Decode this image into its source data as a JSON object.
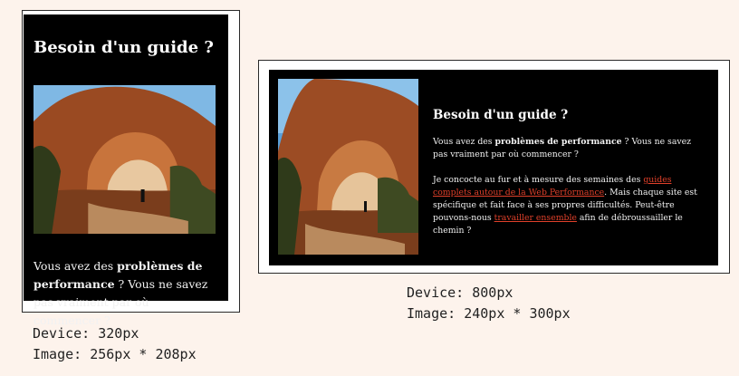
{
  "mobile": {
    "title": "Besoin d'un guide ?",
    "text_before": "Vous avez des ",
    "text_strong": "problèmes de performance",
    "text_after": " ? Vous ne savez pas vraiment par où commencer ?",
    "caption_device": "Device: 320px",
    "caption_image": "Image: 256px * 208px"
  },
  "desktop": {
    "title": "Besoin d'un guide ?",
    "p1_before": "Vous avez des ",
    "p1_strong": "problèmes de performance",
    "p1_after": " ? Vous ne savez pas vraiment par où commencer ?",
    "p2_a": "Je concocte au fur et à mesure des semaines des ",
    "p2_link1": "guides complets autour de la Web Performance",
    "p2_b": ". Mais chaque site est spécifique et fait face à ses propres difficultés. Peut-être pouvons-nous ",
    "p2_link2": "travailler ensemble",
    "p2_c": " afin de débroussailler le chemin ?",
    "caption_device": "Device: 800px",
    "caption_image": "Image: 240px * 300px"
  },
  "colors": {
    "page_bg": "#fdf3ec",
    "card_bg": "#000000",
    "link": "#e0402a"
  }
}
